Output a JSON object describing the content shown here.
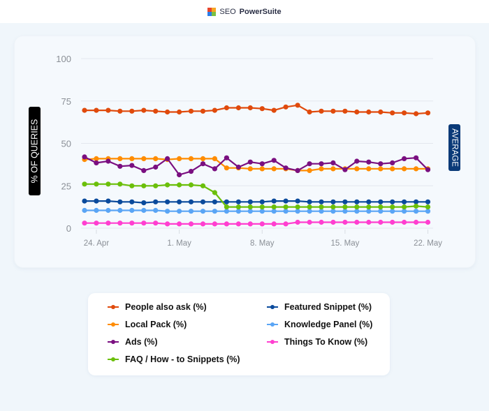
{
  "header": {
    "brand_prefix": "SEO",
    "brand_name": "PowerSuite",
    "logo_colors": [
      "#e8452c",
      "#f6a623",
      "#2b7de9",
      "#7bc043"
    ]
  },
  "chart_data": {
    "type": "line",
    "title": "",
    "xlabel": "",
    "ylabel": "% OF QUERIES",
    "right_label": "AVERAGE",
    "ylim": [
      0,
      100
    ],
    "yticks": [
      0,
      25,
      50,
      75,
      100
    ],
    "grid": true,
    "legend_position": "bottom",
    "x": [
      "23. Apr",
      "24. Apr",
      "25. Apr",
      "26. Apr",
      "27. Apr",
      "28. Apr",
      "29. Apr",
      "30. Apr",
      "1. May",
      "2. May",
      "3. May",
      "4. May",
      "5. May",
      "6. May",
      "7. May",
      "8. May",
      "9. May",
      "10. May",
      "11. May",
      "12. May",
      "13. May",
      "14. May",
      "15. May",
      "16. May",
      "17. May",
      "18. May",
      "19. May",
      "20. May",
      "21. May",
      "22. May"
    ],
    "xtick_labels": [
      "24. Apr",
      "1. May",
      "8. May",
      "15. May",
      "22. May"
    ],
    "xtick_indices": [
      1,
      8,
      15,
      22,
      29
    ],
    "series": [
      {
        "name": "People also ask (%)",
        "color": "#e04a0c",
        "values": [
          69.5,
          69.5,
          69.5,
          69,
          69,
          69.5,
          69,
          68.5,
          68.5,
          69,
          69,
          69.5,
          71,
          71,
          71,
          70.5,
          69.5,
          71.5,
          72.5,
          68.5,
          69,
          69,
          69,
          68.5,
          68.5,
          68.5,
          68,
          68,
          67.5,
          68
        ]
      },
      {
        "name": "Local Pack (%)",
        "color": "#ff8c00",
        "values": [
          40.5,
          41,
          41,
          41,
          41,
          41,
          41,
          40.5,
          41,
          41,
          41,
          41,
          35.5,
          35.5,
          35,
          35,
          35,
          35,
          34,
          34,
          35,
          35,
          35,
          35,
          35,
          35,
          35,
          35,
          35,
          35
        ]
      },
      {
        "name": "Ads (%)",
        "color": "#7a0f80",
        "values": [
          42,
          38.5,
          39.5,
          36.5,
          37,
          34,
          36,
          41,
          31.5,
          33.5,
          38,
          35,
          41.5,
          36,
          39,
          38,
          40,
          35.5,
          34,
          38,
          38,
          38.5,
          34.5,
          39.5,
          39,
          38,
          38.5,
          41,
          41.5,
          34.5
        ]
      },
      {
        "name": "FAQ / How - to Snippets (%)",
        "color": "#6bbf0a",
        "values": [
          26,
          26,
          26,
          26,
          25,
          25,
          25,
          25.5,
          25.5,
          25.5,
          25,
          21,
          12.5,
          12.5,
          12.5,
          12.5,
          12.5,
          12.5,
          12.5,
          12.5,
          12.5,
          12.5,
          12.5,
          12.5,
          12.5,
          12.5,
          12.5,
          12.5,
          13,
          12.5
        ]
      },
      {
        "name": "Featured Snippet (%)",
        "color": "#0a4a9c",
        "values": [
          16,
          16,
          16,
          15.5,
          15.5,
          15,
          15.5,
          15.5,
          15.5,
          15.5,
          15.5,
          15.5,
          15.5,
          15.5,
          15.5,
          15.5,
          16,
          16,
          16,
          15.5,
          15.5,
          15.5,
          15.5,
          15.5,
          15.5,
          15.5,
          15.5,
          15.5,
          15.5,
          15.5
        ]
      },
      {
        "name": "Knowledge Panel (%)",
        "color": "#5aa5f5",
        "values": [
          10.5,
          10.5,
          10.5,
          10.5,
          10.5,
          10.5,
          10.5,
          10,
          10,
          10,
          10,
          10,
          10,
          10,
          10,
          10,
          10,
          10,
          10,
          10,
          10,
          10,
          10,
          10,
          10,
          10,
          10,
          10,
          10,
          10
        ]
      },
      {
        "name": "Things To Know (%)",
        "color": "#ff3fd0",
        "values": [
          3,
          3,
          3,
          3,
          3,
          3,
          3,
          2.5,
          2.5,
          2.5,
          2.5,
          2.5,
          2.5,
          2.5,
          2.5,
          2.5,
          2.5,
          2.5,
          3.5,
          3.5,
          3.5,
          3.5,
          3.5,
          3.5,
          3.5,
          3.5,
          3.5,
          3.5,
          3.5,
          3.5
        ]
      }
    ],
    "legend_order": [
      [
        0,
        4
      ],
      [
        1,
        5
      ],
      [
        2,
        6
      ],
      [
        3,
        null
      ]
    ]
  }
}
